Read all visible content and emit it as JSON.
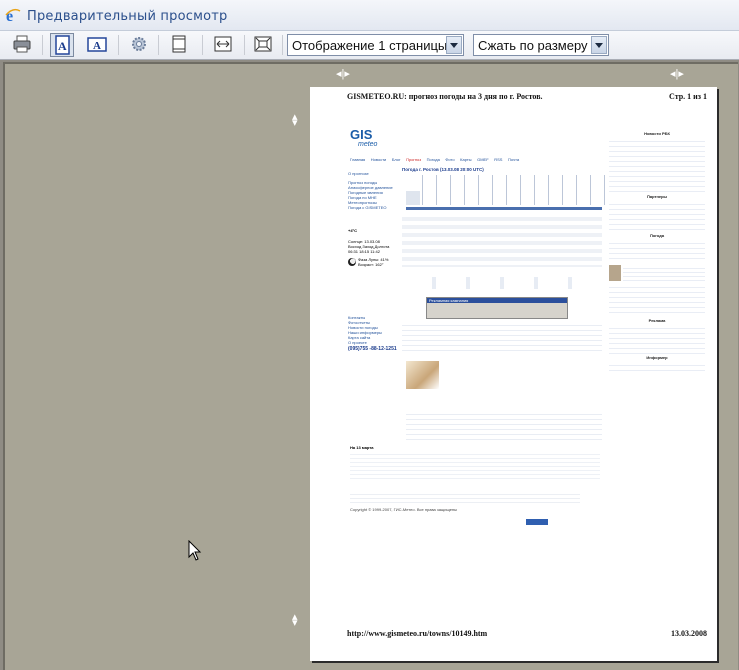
{
  "window": {
    "title": "Предварительный просмотр",
    "app_icon": "ie-icon"
  },
  "toolbar": {
    "buttons": [
      "print-icon",
      "portrait-icon",
      "landscape-icon",
      "page-setup-gear-icon",
      "header-footer-icon",
      "full-width-icon",
      "full-page-icon"
    ],
    "view_select": "Отображение 1 страницы",
    "zoom_select": "Сжать по размеру"
  },
  "page": {
    "header_left": "GISMETEO.RU: прогноз погоды на 3 дня по г. Ростов.",
    "header_right": "Стр. 1 из 1",
    "footer_left": "http://www.gismeteo.ru/towns/10149.htm",
    "footer_right": "13.03.2008"
  },
  "site": {
    "logo_text": "GIS",
    "logo_sub": "meteo",
    "nav_top": [
      "Главная",
      "Новости",
      "Блог",
      "Прогноз",
      "Погода",
      "Фото",
      "Карты",
      "GMEF",
      "RSS",
      "Почта"
    ],
    "city_heading": "Погода г. Ростов (13.03.08 20:00 UTC)",
    "left_links": [
      "О прогнозе",
      "Прогноз погоды",
      "Атмосферное давление",
      "Погодные явления",
      "Погода по МНЕ",
      "Метеопрогнозы",
      "Погода с GISMETEO"
    ],
    "temp_now": "+4°C",
    "sun_info": [
      "Солнце: 13.03.08",
      "Восход  Заход  Долгота",
      "06:31  18:15  11:42"
    ],
    "moon_info": "Фаза Луны: 41%  Возраст: 162°",
    "phone": "(095)755 -88-12-1251",
    "ad_label": "Рекламная кампания",
    "right_col": {
      "news_title": "Новости РБК",
      "adv_title": "Реклама",
      "partners_title": "Партнеры",
      "weather_title": "Погода",
      "info_title": "Информер"
    },
    "bottom_note": "На 13 марта",
    "copyright": "Copyright © 1999-2007, ГИС-Метео. Все права защищены"
  },
  "colors": {
    "title_text": "#2b4f8c",
    "workspace": "#a8a596",
    "link": "#1f4f99"
  }
}
